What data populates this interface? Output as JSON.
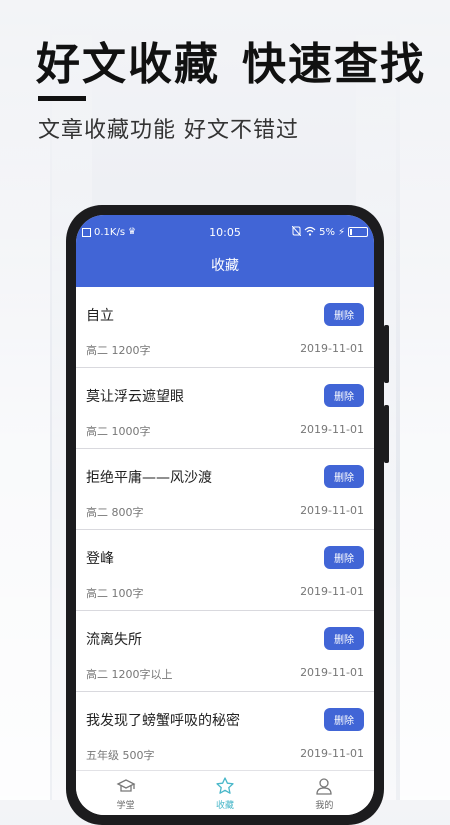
{
  "promo": {
    "headline_left": "好文收藏",
    "headline_right": "快速查找",
    "subline": "文章收藏功能 好文不错过"
  },
  "status_bar": {
    "speed": "0.1K/s",
    "time": "10:05",
    "battery": "5%"
  },
  "header": {
    "title": "收藏"
  },
  "items": [
    {
      "title": "自立",
      "meta": "高二 1200字",
      "date": "2019-11-01",
      "action": "删除"
    },
    {
      "title": "莫让浮云遮望眼",
      "meta": "高二 1000字",
      "date": "2019-11-01",
      "action": "删除"
    },
    {
      "title": "拒绝平庸——风沙渡",
      "meta": "高二 800字",
      "date": "2019-11-01",
      "action": "删除"
    },
    {
      "title": "登峰",
      "meta": "高二 100字",
      "date": "2019-11-01",
      "action": "删除"
    },
    {
      "title": "流离失所",
      "meta": "高二 1200字以上",
      "date": "2019-11-01",
      "action": "删除"
    },
    {
      "title": "我发现了螃蟹呼吸的秘密",
      "meta": "五年级 500字",
      "date": "2019-11-01",
      "action": "删除"
    }
  ],
  "tabbar": {
    "tabs": [
      {
        "label": "学堂",
        "icon": "school-icon",
        "active": false
      },
      {
        "label": "收藏",
        "icon": "star-icon",
        "active": true
      },
      {
        "label": "我的",
        "icon": "user-icon",
        "active": false
      }
    ]
  },
  "colors": {
    "accent": "#4165d6",
    "active_tab": "#49b7c9"
  }
}
